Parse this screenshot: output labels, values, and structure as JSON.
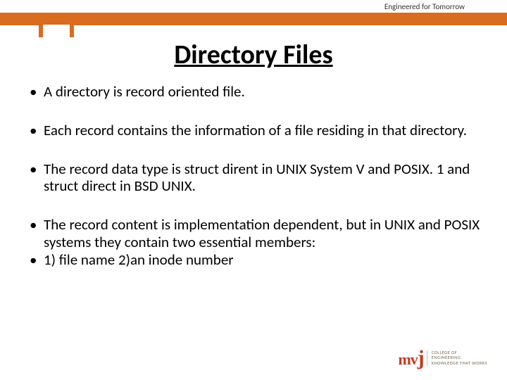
{
  "header": {
    "tagline": "Engineered for Tomorrow"
  },
  "title": "Directory Files",
  "bullets": {
    "b1": "A directory is record oriented file.",
    "b2": "Each record contains the information of a file residing in that directory.",
    "b3": "The record data type is struct dirent in UNIX System V and POSIX. 1 and struct direct in BSD UNIX.",
    "b4": "The record content is implementation dependent, but in UNIX and POSIX systems they contain two essential members:",
    "b5": "1) file name   2)an inode number"
  },
  "logo": {
    "mark_prefix": "mv",
    "mark_j": "j",
    "line1": "COLLEGE OF",
    "line2": "ENGINEERING",
    "line3": "KNOWLEDGE THAT WORKS"
  }
}
